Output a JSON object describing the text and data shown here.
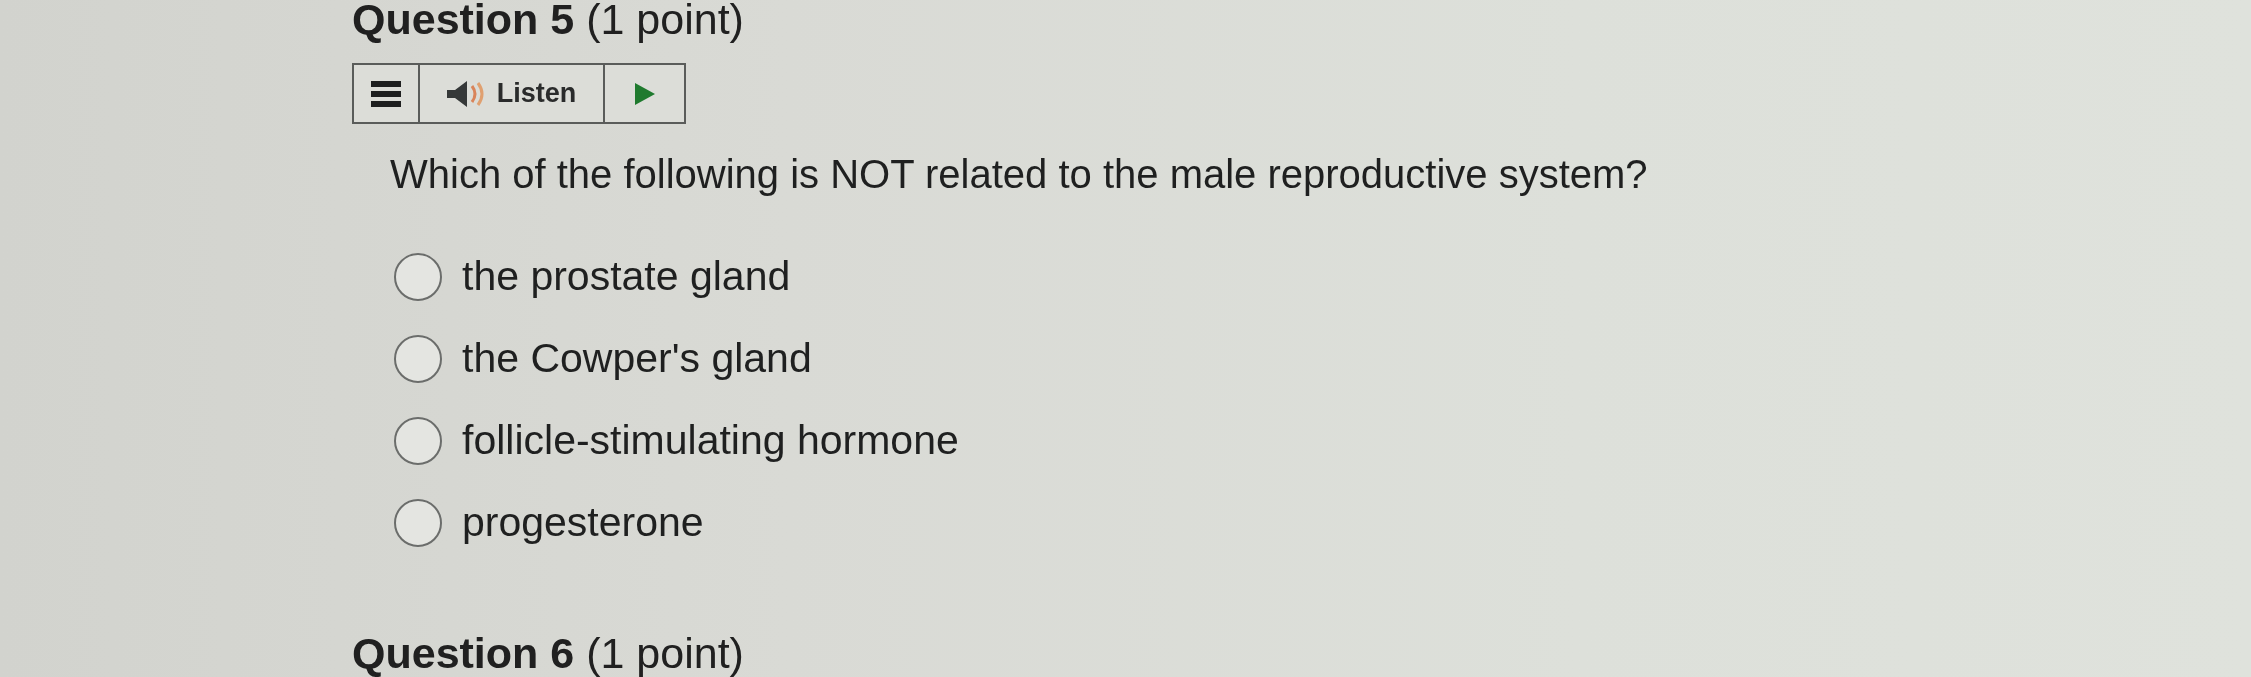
{
  "question": {
    "title": "**Question 5** (1 point)",
    "listen_bar": {
      "label": "Listen"
    },
    "text": "Which of the following is NOT related to the male reproductive system?",
    "options": [
      {
        "label": "the prostate gland",
        "selected": false
      },
      {
        "label": "the Cowper's gland",
        "selected": false
      },
      {
        "label": "follicle-stimulating hormone",
        "selected": false
      },
      {
        "label": "progesterone",
        "selected": false
      }
    ]
  },
  "next_question": {
    "title": "**Question 6** (1 point)"
  }
}
